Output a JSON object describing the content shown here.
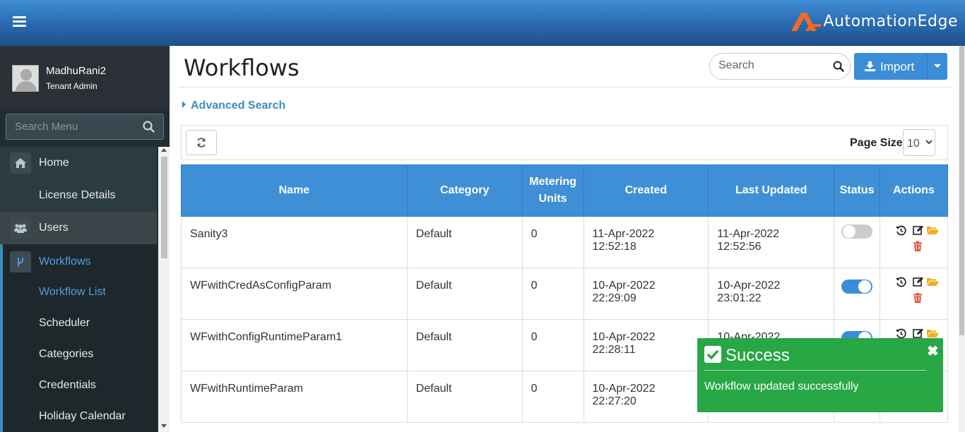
{
  "header": {
    "brand_name": "AutomationEdge",
    "accent_color": "#f26b21"
  },
  "user": {
    "name": "MadhuRani2",
    "role": "Tenant Admin"
  },
  "menu_search": {
    "placeholder": "Search Menu"
  },
  "menu": {
    "home": "Home",
    "license": "License Details",
    "users": "Users",
    "workflows": "Workflows",
    "workflow_list": "Workflow List",
    "scheduler": "Scheduler",
    "categories": "Categories",
    "credentials": "Credentials",
    "holiday_calendar": "Holiday Calendar"
  },
  "page": {
    "title": "Workflows",
    "search_placeholder": "Search",
    "import_label": "Import",
    "advanced_search": "Advanced Search",
    "page_size_label": "Page Size",
    "page_size_value": "10"
  },
  "table": {
    "headers": {
      "name": "Name",
      "category": "Category",
      "metering_1": "Metering",
      "metering_2": "Units",
      "created": "Created",
      "last_updated": "Last Updated",
      "status": "Status",
      "actions": "Actions"
    },
    "rows": [
      {
        "name": "Sanity3",
        "category": "Default",
        "metering": "0",
        "created": "11-Apr-2022 12:52:18",
        "updated": "11-Apr-2022 12:52:56",
        "status_enabled": false
      },
      {
        "name": "WFwithCredAsConfigParam",
        "category": "Default",
        "metering": "0",
        "created": "10-Apr-2022 22:29:09",
        "updated": "10-Apr-2022 23:01:22",
        "status_enabled": true
      },
      {
        "name": "WFwithConfigRuntimeParam1",
        "category": "Default",
        "metering": "0",
        "created": "10-Apr-2022 22:28:11",
        "updated": "10-Apr-2022 23:01:22",
        "status_enabled": true
      },
      {
        "name": "WFwithRuntimeParam",
        "category": "Default",
        "metering": "0",
        "created": "10-Apr-2022 22:27:20",
        "updated": "",
        "status_enabled": true
      }
    ]
  },
  "toast": {
    "title": "Success",
    "message": "Workflow updated successfully",
    "color": "#28a745"
  },
  "colors": {
    "primary": "#3f8fd6",
    "sidebar": "#222d32",
    "active_link": "#4d9ee0",
    "delete": "#dd4b39",
    "folder": "#f0ad1e"
  }
}
